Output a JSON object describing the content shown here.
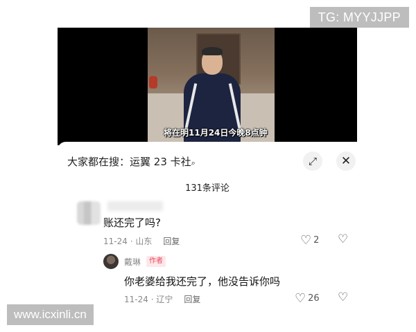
{
  "watermarks": {
    "top_right": "TG: MYYJJPP",
    "bottom_left": "www.icxinli.cn"
  },
  "video": {
    "subtitle": "将在明11月24日今晚8点钟"
  },
  "panel": {
    "search_prefix": "大家都在搜：",
    "search_query": "运翼 23 卡社",
    "expand_icon": "expand-icon",
    "close_icon": "close-icon",
    "comment_count": "131条评论"
  },
  "comments": [
    {
      "text": "账还完了吗?",
      "date": "11-24",
      "location": "山东",
      "reply_label": "回复",
      "likes": "2"
    },
    {
      "author": "戴琳",
      "badge": "作者",
      "text": "你老婆给我还完了，他没告诉你吗",
      "date": "11-24",
      "location": "辽宁",
      "reply_label": "回复",
      "likes": "26"
    }
  ]
}
